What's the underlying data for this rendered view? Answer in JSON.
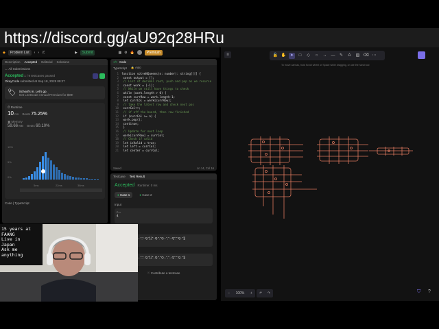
{
  "banner": {
    "url": "https://discord.gg/aU92q28HRu"
  },
  "topbar": {
    "problem_list": "Problem List",
    "submit": "Submit",
    "premium": "Premium"
  },
  "left": {
    "tabs": [
      "Description",
      "Accepted",
      "Editorial",
      "Solutions"
    ],
    "all_submissions": "All Submissions",
    "status": "Accepted",
    "passed": "1 / 9 testcases passed",
    "user": "OkayCode",
    "submitted": "submitted at Sep 18, 2025 09:27",
    "promo_title": "School's in. Let's go.",
    "promo_sub": "Get LeetCode Annual Premium for $99!",
    "runtime_label": "Runtime",
    "runtime_value": "10",
    "runtime_unit": "ms",
    "beats_label": "Beats",
    "beats_value": "75.25%",
    "memory_label": "Memory",
    "memory_value": "59.66",
    "memory_unit": "MB",
    "mem_beats_value": "60.10%",
    "axis_ticks": [
      "10%",
      "5%",
      "0%"
    ],
    "x_ticks": [
      "5ms",
      "22ms",
      "38ms"
    ],
    "code_label": "Code",
    "lang_label": "TypeScript"
  },
  "code": {
    "title": "Code",
    "lang": "TypeScript",
    "auto": "Auto",
    "status": "Saved",
    "position": "Ln 14, Col 16",
    "lines": [
      "function solveNQueens(n: number): string[][] {",
      "  const output = [];",
      "  // List of decimal root, push and pop as we recurse",
      "  const work = [-1];",
      "  // While we still have things to check",
      "  while (work.length > 0) {",
      "    const currRow = work.length-1;",
      "    let currCol = work[currRow];",
      "    // take the latest row and check next pos",
      "    currCol++;",
      "    // if off the board, then row finished",
      "    if (currCol >= n) {",
      "      work.pop();",
      "      continue;",
      "    }",
      "    // Update for next loop",
      "    work[currRow] = currCol;",
      "    // Check if valid",
      "    let isValid = true;",
      "    let left = currCol;",
      "    let center = currCol;"
    ]
  },
  "test": {
    "tab1": "Testcase",
    "tab2": "Test Result",
    "status": "Accepted",
    "runtime": "Runtime: 0 ms",
    "case1": "Case 1",
    "case2": "Case 2",
    "input_label": "Input",
    "input_var": "n =",
    "input_val": "4",
    "output1": "[[\".Q..\",\"...Q\",\"Q...\",\"..Q.\"],[\"..Q.\",\"Q...\",\"...Q\",\".Q..\"]]",
    "output2": "[[\".Q..\",\"...Q\",\"Q...\",\"..Q.\"],[\"..Q.\",\"Q...\",\"...Q\",\".Q..\"]]",
    "contribute": "Contribute a testcase"
  },
  "whiteboard": {
    "hint": "To move canvas, hold Scroll wheel or Space while dragging, or use the hand tool",
    "zoom": "100%",
    "tools": [
      "lock",
      "hand",
      "select",
      "rectangle",
      "diamond",
      "ellipse",
      "arrow",
      "line",
      "draw",
      "text",
      "image",
      "eraser",
      "more"
    ]
  },
  "chat": {
    "lines": [
      "15 years at",
      "FAANG",
      "Live in",
      "Japan",
      "Ask me",
      "anything"
    ]
  },
  "colors": {
    "accepted": "#2cbb5d",
    "premium": "#c78c2b",
    "drawing": "#e07a5f",
    "tool_selected": "#403e6a"
  }
}
